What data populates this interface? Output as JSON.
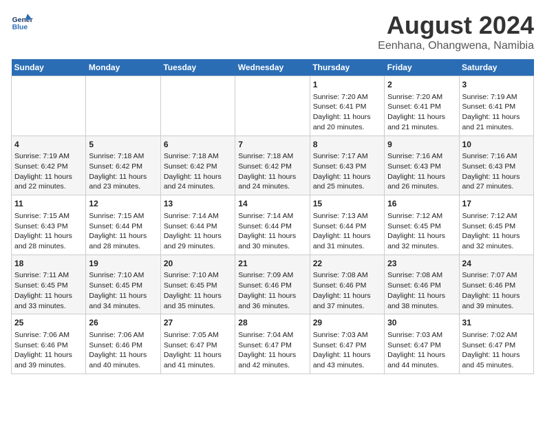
{
  "logo": {
    "line1": "General",
    "line2": "Blue"
  },
  "title": "August 2024",
  "subtitle": "Eenhana, Ohangwena, Namibia",
  "days_of_week": [
    "Sunday",
    "Monday",
    "Tuesday",
    "Wednesday",
    "Thursday",
    "Friday",
    "Saturday"
  ],
  "weeks": [
    [
      {
        "day": "",
        "sunrise": "",
        "sunset": "",
        "daylight": ""
      },
      {
        "day": "",
        "sunrise": "",
        "sunset": "",
        "daylight": ""
      },
      {
        "day": "",
        "sunrise": "",
        "sunset": "",
        "daylight": ""
      },
      {
        "day": "",
        "sunrise": "",
        "sunset": "",
        "daylight": ""
      },
      {
        "day": "1",
        "sunrise": "Sunrise: 7:20 AM",
        "sunset": "Sunset: 6:41 PM",
        "daylight": "Daylight: 11 hours and 20 minutes."
      },
      {
        "day": "2",
        "sunrise": "Sunrise: 7:20 AM",
        "sunset": "Sunset: 6:41 PM",
        "daylight": "Daylight: 11 hours and 21 minutes."
      },
      {
        "day": "3",
        "sunrise": "Sunrise: 7:19 AM",
        "sunset": "Sunset: 6:41 PM",
        "daylight": "Daylight: 11 hours and 21 minutes."
      }
    ],
    [
      {
        "day": "4",
        "sunrise": "Sunrise: 7:19 AM",
        "sunset": "Sunset: 6:42 PM",
        "daylight": "Daylight: 11 hours and 22 minutes."
      },
      {
        "day": "5",
        "sunrise": "Sunrise: 7:18 AM",
        "sunset": "Sunset: 6:42 PM",
        "daylight": "Daylight: 11 hours and 23 minutes."
      },
      {
        "day": "6",
        "sunrise": "Sunrise: 7:18 AM",
        "sunset": "Sunset: 6:42 PM",
        "daylight": "Daylight: 11 hours and 24 minutes."
      },
      {
        "day": "7",
        "sunrise": "Sunrise: 7:18 AM",
        "sunset": "Sunset: 6:42 PM",
        "daylight": "Daylight: 11 hours and 24 minutes."
      },
      {
        "day": "8",
        "sunrise": "Sunrise: 7:17 AM",
        "sunset": "Sunset: 6:43 PM",
        "daylight": "Daylight: 11 hours and 25 minutes."
      },
      {
        "day": "9",
        "sunrise": "Sunrise: 7:16 AM",
        "sunset": "Sunset: 6:43 PM",
        "daylight": "Daylight: 11 hours and 26 minutes."
      },
      {
        "day": "10",
        "sunrise": "Sunrise: 7:16 AM",
        "sunset": "Sunset: 6:43 PM",
        "daylight": "Daylight: 11 hours and 27 minutes."
      }
    ],
    [
      {
        "day": "11",
        "sunrise": "Sunrise: 7:15 AM",
        "sunset": "Sunset: 6:43 PM",
        "daylight": "Daylight: 11 hours and 28 minutes."
      },
      {
        "day": "12",
        "sunrise": "Sunrise: 7:15 AM",
        "sunset": "Sunset: 6:44 PM",
        "daylight": "Daylight: 11 hours and 28 minutes."
      },
      {
        "day": "13",
        "sunrise": "Sunrise: 7:14 AM",
        "sunset": "Sunset: 6:44 PM",
        "daylight": "Daylight: 11 hours and 29 minutes."
      },
      {
        "day": "14",
        "sunrise": "Sunrise: 7:14 AM",
        "sunset": "Sunset: 6:44 PM",
        "daylight": "Daylight: 11 hours and 30 minutes."
      },
      {
        "day": "15",
        "sunrise": "Sunrise: 7:13 AM",
        "sunset": "Sunset: 6:44 PM",
        "daylight": "Daylight: 11 hours and 31 minutes."
      },
      {
        "day": "16",
        "sunrise": "Sunrise: 7:12 AM",
        "sunset": "Sunset: 6:45 PM",
        "daylight": "Daylight: 11 hours and 32 minutes."
      },
      {
        "day": "17",
        "sunrise": "Sunrise: 7:12 AM",
        "sunset": "Sunset: 6:45 PM",
        "daylight": "Daylight: 11 hours and 32 minutes."
      }
    ],
    [
      {
        "day": "18",
        "sunrise": "Sunrise: 7:11 AM",
        "sunset": "Sunset: 6:45 PM",
        "daylight": "Daylight: 11 hours and 33 minutes."
      },
      {
        "day": "19",
        "sunrise": "Sunrise: 7:10 AM",
        "sunset": "Sunset: 6:45 PM",
        "daylight": "Daylight: 11 hours and 34 minutes."
      },
      {
        "day": "20",
        "sunrise": "Sunrise: 7:10 AM",
        "sunset": "Sunset: 6:45 PM",
        "daylight": "Daylight: 11 hours and 35 minutes."
      },
      {
        "day": "21",
        "sunrise": "Sunrise: 7:09 AM",
        "sunset": "Sunset: 6:46 PM",
        "daylight": "Daylight: 11 hours and 36 minutes."
      },
      {
        "day": "22",
        "sunrise": "Sunrise: 7:08 AM",
        "sunset": "Sunset: 6:46 PM",
        "daylight": "Daylight: 11 hours and 37 minutes."
      },
      {
        "day": "23",
        "sunrise": "Sunrise: 7:08 AM",
        "sunset": "Sunset: 6:46 PM",
        "daylight": "Daylight: 11 hours and 38 minutes."
      },
      {
        "day": "24",
        "sunrise": "Sunrise: 7:07 AM",
        "sunset": "Sunset: 6:46 PM",
        "daylight": "Daylight: 11 hours and 39 minutes."
      }
    ],
    [
      {
        "day": "25",
        "sunrise": "Sunrise: 7:06 AM",
        "sunset": "Sunset: 6:46 PM",
        "daylight": "Daylight: 11 hours and 39 minutes."
      },
      {
        "day": "26",
        "sunrise": "Sunrise: 7:06 AM",
        "sunset": "Sunset: 6:46 PM",
        "daylight": "Daylight: 11 hours and 40 minutes."
      },
      {
        "day": "27",
        "sunrise": "Sunrise: 7:05 AM",
        "sunset": "Sunset: 6:47 PM",
        "daylight": "Daylight: 11 hours and 41 minutes."
      },
      {
        "day": "28",
        "sunrise": "Sunrise: 7:04 AM",
        "sunset": "Sunset: 6:47 PM",
        "daylight": "Daylight: 11 hours and 42 minutes."
      },
      {
        "day": "29",
        "sunrise": "Sunrise: 7:03 AM",
        "sunset": "Sunset: 6:47 PM",
        "daylight": "Daylight: 11 hours and 43 minutes."
      },
      {
        "day": "30",
        "sunrise": "Sunrise: 7:03 AM",
        "sunset": "Sunset: 6:47 PM",
        "daylight": "Daylight: 11 hours and 44 minutes."
      },
      {
        "day": "31",
        "sunrise": "Sunrise: 7:02 AM",
        "sunset": "Sunset: 6:47 PM",
        "daylight": "Daylight: 11 hours and 45 minutes."
      }
    ]
  ]
}
